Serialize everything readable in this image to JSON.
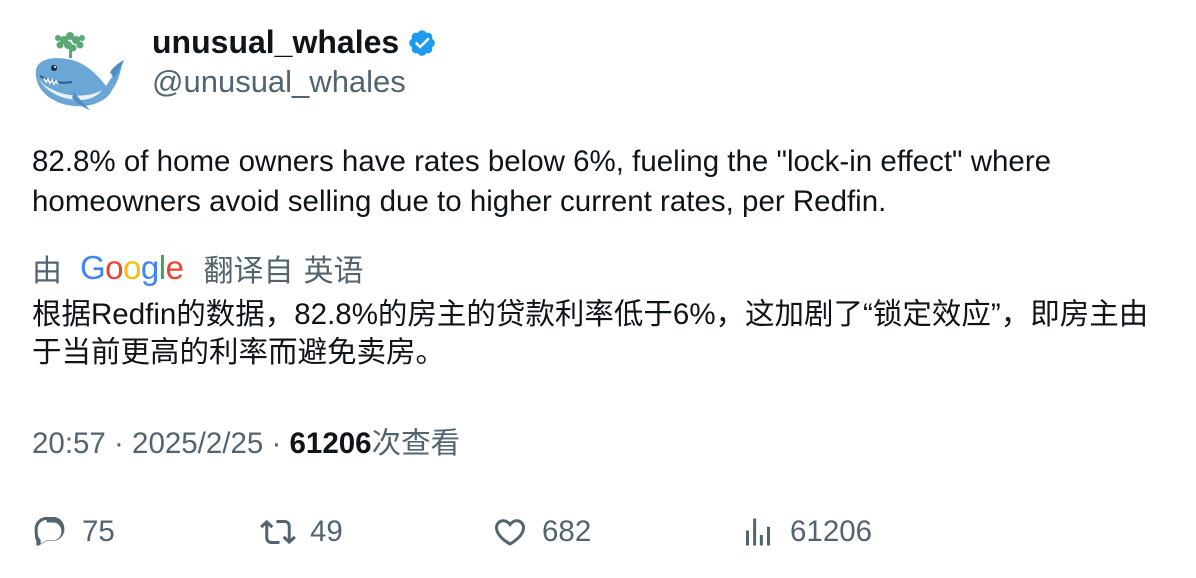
{
  "author": {
    "display_name": "unusual_whales",
    "handle": "@unusual_whales",
    "verified": true,
    "avatar_icon": "whale-avatar-icon",
    "verified_color": "#1d9bf0"
  },
  "tweet": {
    "text": "82.8% of home owners have rates below 6%, fueling the \"lock-in effect\" where homeowners avoid selling due to higher current rates, per Redfin."
  },
  "translation": {
    "by_label": "由",
    "provider": "Google",
    "from_label": "翻译自",
    "language": "英语",
    "text": "根据Redfin的数据，82.8%的房主的贷款利率低于6%，这加剧了“锁定效应”，即房主由于当前更高的利率而避免卖房。"
  },
  "meta": {
    "time": "20:57",
    "separator": " · ",
    "date": "2025/2/25",
    "views_count": "61206",
    "views_label": "次查看"
  },
  "actions": {
    "reply": {
      "icon": "reply-icon",
      "count": "75"
    },
    "retweet": {
      "icon": "retweet-icon",
      "count": "49"
    },
    "like": {
      "icon": "heart-icon",
      "count": "682"
    },
    "views": {
      "icon": "views-chart-icon",
      "count": "61206"
    }
  },
  "colors": {
    "text_primary": "#0f1419",
    "text_secondary": "#536471",
    "accent": "#1d9bf0"
  }
}
